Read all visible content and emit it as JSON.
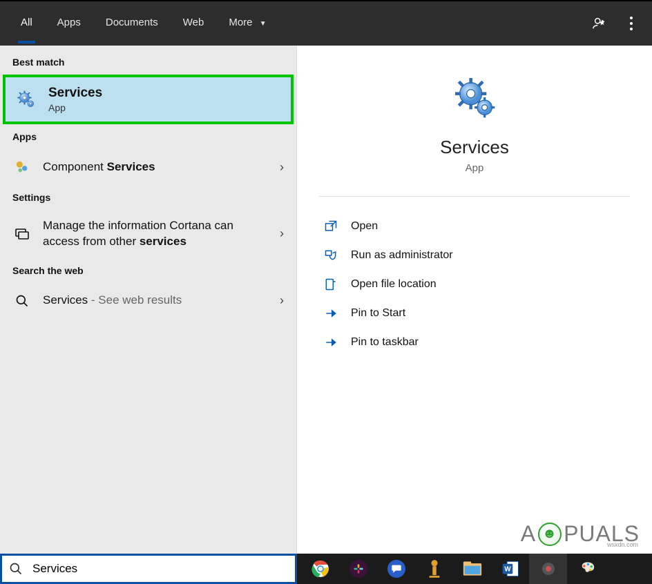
{
  "topbar": {
    "tabs": {
      "all": "All",
      "apps": "Apps",
      "docs": "Documents",
      "web": "Web",
      "more": "More"
    }
  },
  "left": {
    "best_match_header": "Best match",
    "best_match": {
      "title": "Services",
      "subtitle": "App"
    },
    "apps_header": "Apps",
    "apps_row_prefix": "Component ",
    "apps_row_bold": "Services",
    "settings_header": "Settings",
    "settings_row_line1": "Manage the information Cortana can",
    "settings_row_line2_plain": "access from other ",
    "settings_row_line2_bold": "services",
    "web_header": "Search the web",
    "web_row_term": "Services",
    "web_row_trail": " - See web results"
  },
  "preview": {
    "title": "Services",
    "subtitle": "App",
    "actions": {
      "open": "Open",
      "admin": "Run as administrator",
      "location": "Open file location",
      "pin_start": "Pin to Start",
      "pin_taskbar": "Pin to taskbar"
    }
  },
  "search": {
    "value": "Services"
  },
  "watermark": {
    "pre": "A",
    "post": "PUALS",
    "tiny": "wsxdn.com"
  },
  "colors": {
    "accent": "#0a4fa0",
    "highlight_border": "#00c400",
    "bestmatch_bg": "#bde0f0"
  }
}
